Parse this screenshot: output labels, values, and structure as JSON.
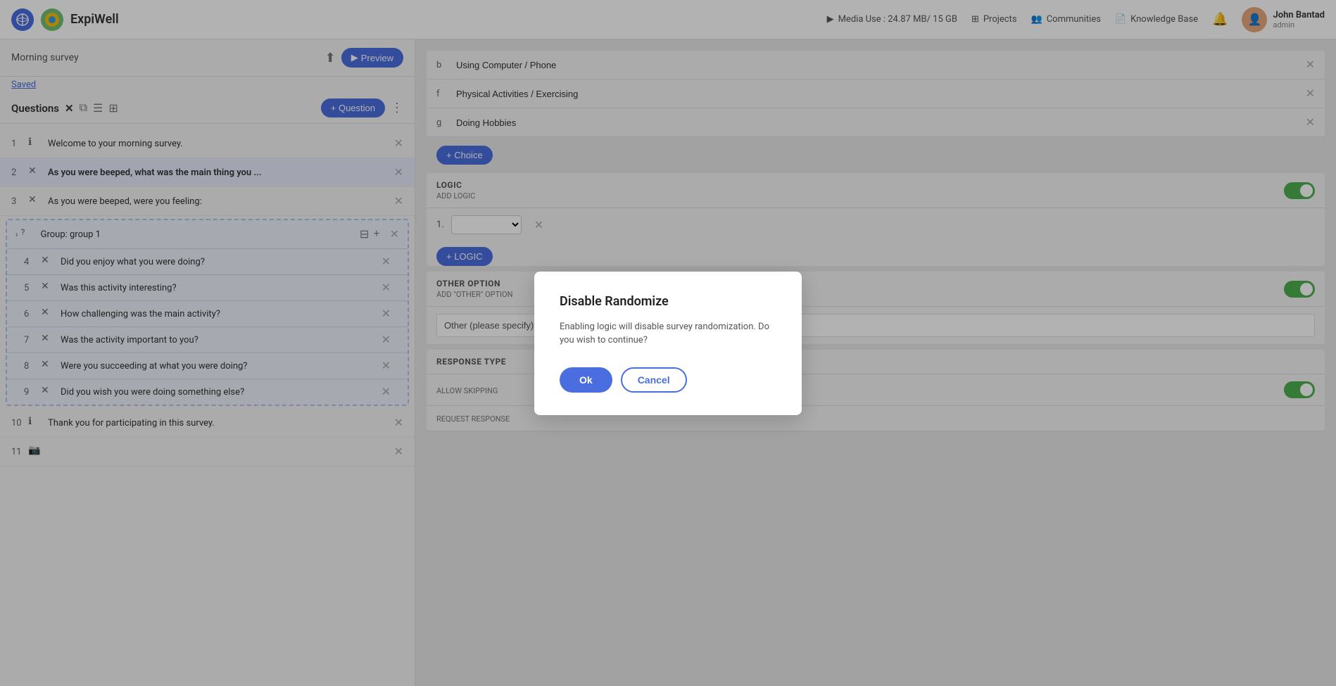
{
  "header": {
    "brand": "ExpiWell",
    "media_label": "Media Use : 24.87 MB/ 15 GB",
    "projects_label": "Projects",
    "communities_label": "Communities",
    "knowledge_base_label": "Knowledge Base",
    "username": "John Bantad",
    "role": "admin"
  },
  "left_panel": {
    "survey_title": "Morning survey",
    "preview_label": "Preview",
    "saved_label": "Saved",
    "questions_title": "Questions",
    "add_question_label": "+ Question",
    "questions": [
      {
        "num": "1",
        "type": "info",
        "text": "Welcome to your morning survey."
      },
      {
        "num": "2",
        "type": "matrix",
        "text": "As you were beeped, what was the main thing you ...",
        "bold": true
      },
      {
        "num": "3",
        "type": "matrix",
        "text": "As you were beeped, were you feeling:"
      },
      {
        "num": "4",
        "type": "matrix",
        "text": "Did you enjoy what you were doing?",
        "inGroup": true
      },
      {
        "num": "5",
        "type": "matrix",
        "text": "Was this activity interesting?",
        "inGroup": true
      },
      {
        "num": "6",
        "type": "matrix",
        "text": "How challenging was the main activity?",
        "inGroup": true
      },
      {
        "num": "7",
        "type": "matrix",
        "text": "Was the activity important to you?",
        "inGroup": true
      },
      {
        "num": "8",
        "type": "matrix",
        "text": "Were you succeeding at what you were doing?",
        "inGroup": true
      },
      {
        "num": "9",
        "type": "matrix",
        "text": "Did you wish you were doing something else?",
        "inGroup": true
      },
      {
        "num": "10",
        "type": "info",
        "text": "Thank you for participating in this survey."
      },
      {
        "num": "11",
        "type": "camera",
        "text": ""
      }
    ],
    "group_label": "Group: group 1"
  },
  "right_panel": {
    "choices": [
      {
        "label": "b",
        "value": "Using Computer / Phone"
      },
      {
        "label": "f",
        "value": "Physical Activities / Exercising"
      },
      {
        "label": "g",
        "value": "Doing Hobbies"
      }
    ],
    "add_choice_label": "+ Choice",
    "logic_section": {
      "title": "LOGIC",
      "subtitle": "ADD LOGIC",
      "add_logic_label": "+ LOGIC"
    },
    "other_option_section": {
      "title": "OTHER OPTION",
      "subtitle": "ADD \"OTHER\" OPTION",
      "placeholder": "Other (please specify)"
    },
    "response_type_section": {
      "title": "RESPONSE TYPE",
      "allow_skipping_label": "ALLOW SKIPPING",
      "request_response_label": "REQUEST RESPONSE"
    }
  },
  "modal": {
    "title": "Disable Randomize",
    "message": "Enabling logic will disable survey randomization. Do you wish to continue?",
    "ok_label": "Ok",
    "cancel_label": "Cancel"
  }
}
